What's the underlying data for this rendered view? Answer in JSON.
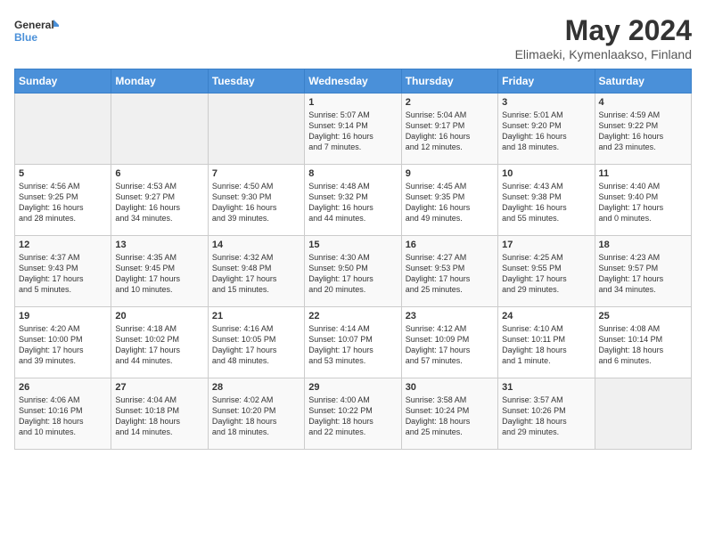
{
  "logo": {
    "general": "General",
    "blue": "Blue"
  },
  "title": "May 2024",
  "subtitle": "Elimaeki, Kymenlaakso, Finland",
  "days_of_week": [
    "Sunday",
    "Monday",
    "Tuesday",
    "Wednesday",
    "Thursday",
    "Friday",
    "Saturday"
  ],
  "weeks": [
    [
      {
        "day": "",
        "info": ""
      },
      {
        "day": "",
        "info": ""
      },
      {
        "day": "",
        "info": ""
      },
      {
        "day": "1",
        "info": "Sunrise: 5:07 AM\nSunset: 9:14 PM\nDaylight: 16 hours\nand 7 minutes."
      },
      {
        "day": "2",
        "info": "Sunrise: 5:04 AM\nSunset: 9:17 PM\nDaylight: 16 hours\nand 12 minutes."
      },
      {
        "day": "3",
        "info": "Sunrise: 5:01 AM\nSunset: 9:20 PM\nDaylight: 16 hours\nand 18 minutes."
      },
      {
        "day": "4",
        "info": "Sunrise: 4:59 AM\nSunset: 9:22 PM\nDaylight: 16 hours\nand 23 minutes."
      }
    ],
    [
      {
        "day": "5",
        "info": "Sunrise: 4:56 AM\nSunset: 9:25 PM\nDaylight: 16 hours\nand 28 minutes."
      },
      {
        "day": "6",
        "info": "Sunrise: 4:53 AM\nSunset: 9:27 PM\nDaylight: 16 hours\nand 34 minutes."
      },
      {
        "day": "7",
        "info": "Sunrise: 4:50 AM\nSunset: 9:30 PM\nDaylight: 16 hours\nand 39 minutes."
      },
      {
        "day": "8",
        "info": "Sunrise: 4:48 AM\nSunset: 9:32 PM\nDaylight: 16 hours\nand 44 minutes."
      },
      {
        "day": "9",
        "info": "Sunrise: 4:45 AM\nSunset: 9:35 PM\nDaylight: 16 hours\nand 49 minutes."
      },
      {
        "day": "10",
        "info": "Sunrise: 4:43 AM\nSunset: 9:38 PM\nDaylight: 16 hours\nand 55 minutes."
      },
      {
        "day": "11",
        "info": "Sunrise: 4:40 AM\nSunset: 9:40 PM\nDaylight: 17 hours\nand 0 minutes."
      }
    ],
    [
      {
        "day": "12",
        "info": "Sunrise: 4:37 AM\nSunset: 9:43 PM\nDaylight: 17 hours\nand 5 minutes."
      },
      {
        "day": "13",
        "info": "Sunrise: 4:35 AM\nSunset: 9:45 PM\nDaylight: 17 hours\nand 10 minutes."
      },
      {
        "day": "14",
        "info": "Sunrise: 4:32 AM\nSunset: 9:48 PM\nDaylight: 17 hours\nand 15 minutes."
      },
      {
        "day": "15",
        "info": "Sunrise: 4:30 AM\nSunset: 9:50 PM\nDaylight: 17 hours\nand 20 minutes."
      },
      {
        "day": "16",
        "info": "Sunrise: 4:27 AM\nSunset: 9:53 PM\nDaylight: 17 hours\nand 25 minutes."
      },
      {
        "day": "17",
        "info": "Sunrise: 4:25 AM\nSunset: 9:55 PM\nDaylight: 17 hours\nand 29 minutes."
      },
      {
        "day": "18",
        "info": "Sunrise: 4:23 AM\nSunset: 9:57 PM\nDaylight: 17 hours\nand 34 minutes."
      }
    ],
    [
      {
        "day": "19",
        "info": "Sunrise: 4:20 AM\nSunset: 10:00 PM\nDaylight: 17 hours\nand 39 minutes."
      },
      {
        "day": "20",
        "info": "Sunrise: 4:18 AM\nSunset: 10:02 PM\nDaylight: 17 hours\nand 44 minutes."
      },
      {
        "day": "21",
        "info": "Sunrise: 4:16 AM\nSunset: 10:05 PM\nDaylight: 17 hours\nand 48 minutes."
      },
      {
        "day": "22",
        "info": "Sunrise: 4:14 AM\nSunset: 10:07 PM\nDaylight: 17 hours\nand 53 minutes."
      },
      {
        "day": "23",
        "info": "Sunrise: 4:12 AM\nSunset: 10:09 PM\nDaylight: 17 hours\nand 57 minutes."
      },
      {
        "day": "24",
        "info": "Sunrise: 4:10 AM\nSunset: 10:11 PM\nDaylight: 18 hours\nand 1 minute."
      },
      {
        "day": "25",
        "info": "Sunrise: 4:08 AM\nSunset: 10:14 PM\nDaylight: 18 hours\nand 6 minutes."
      }
    ],
    [
      {
        "day": "26",
        "info": "Sunrise: 4:06 AM\nSunset: 10:16 PM\nDaylight: 18 hours\nand 10 minutes."
      },
      {
        "day": "27",
        "info": "Sunrise: 4:04 AM\nSunset: 10:18 PM\nDaylight: 18 hours\nand 14 minutes."
      },
      {
        "day": "28",
        "info": "Sunrise: 4:02 AM\nSunset: 10:20 PM\nDaylight: 18 hours\nand 18 minutes."
      },
      {
        "day": "29",
        "info": "Sunrise: 4:00 AM\nSunset: 10:22 PM\nDaylight: 18 hours\nand 22 minutes."
      },
      {
        "day": "30",
        "info": "Sunrise: 3:58 AM\nSunset: 10:24 PM\nDaylight: 18 hours\nand 25 minutes."
      },
      {
        "day": "31",
        "info": "Sunrise: 3:57 AM\nSunset: 10:26 PM\nDaylight: 18 hours\nand 29 minutes."
      },
      {
        "day": "",
        "info": ""
      }
    ]
  ]
}
